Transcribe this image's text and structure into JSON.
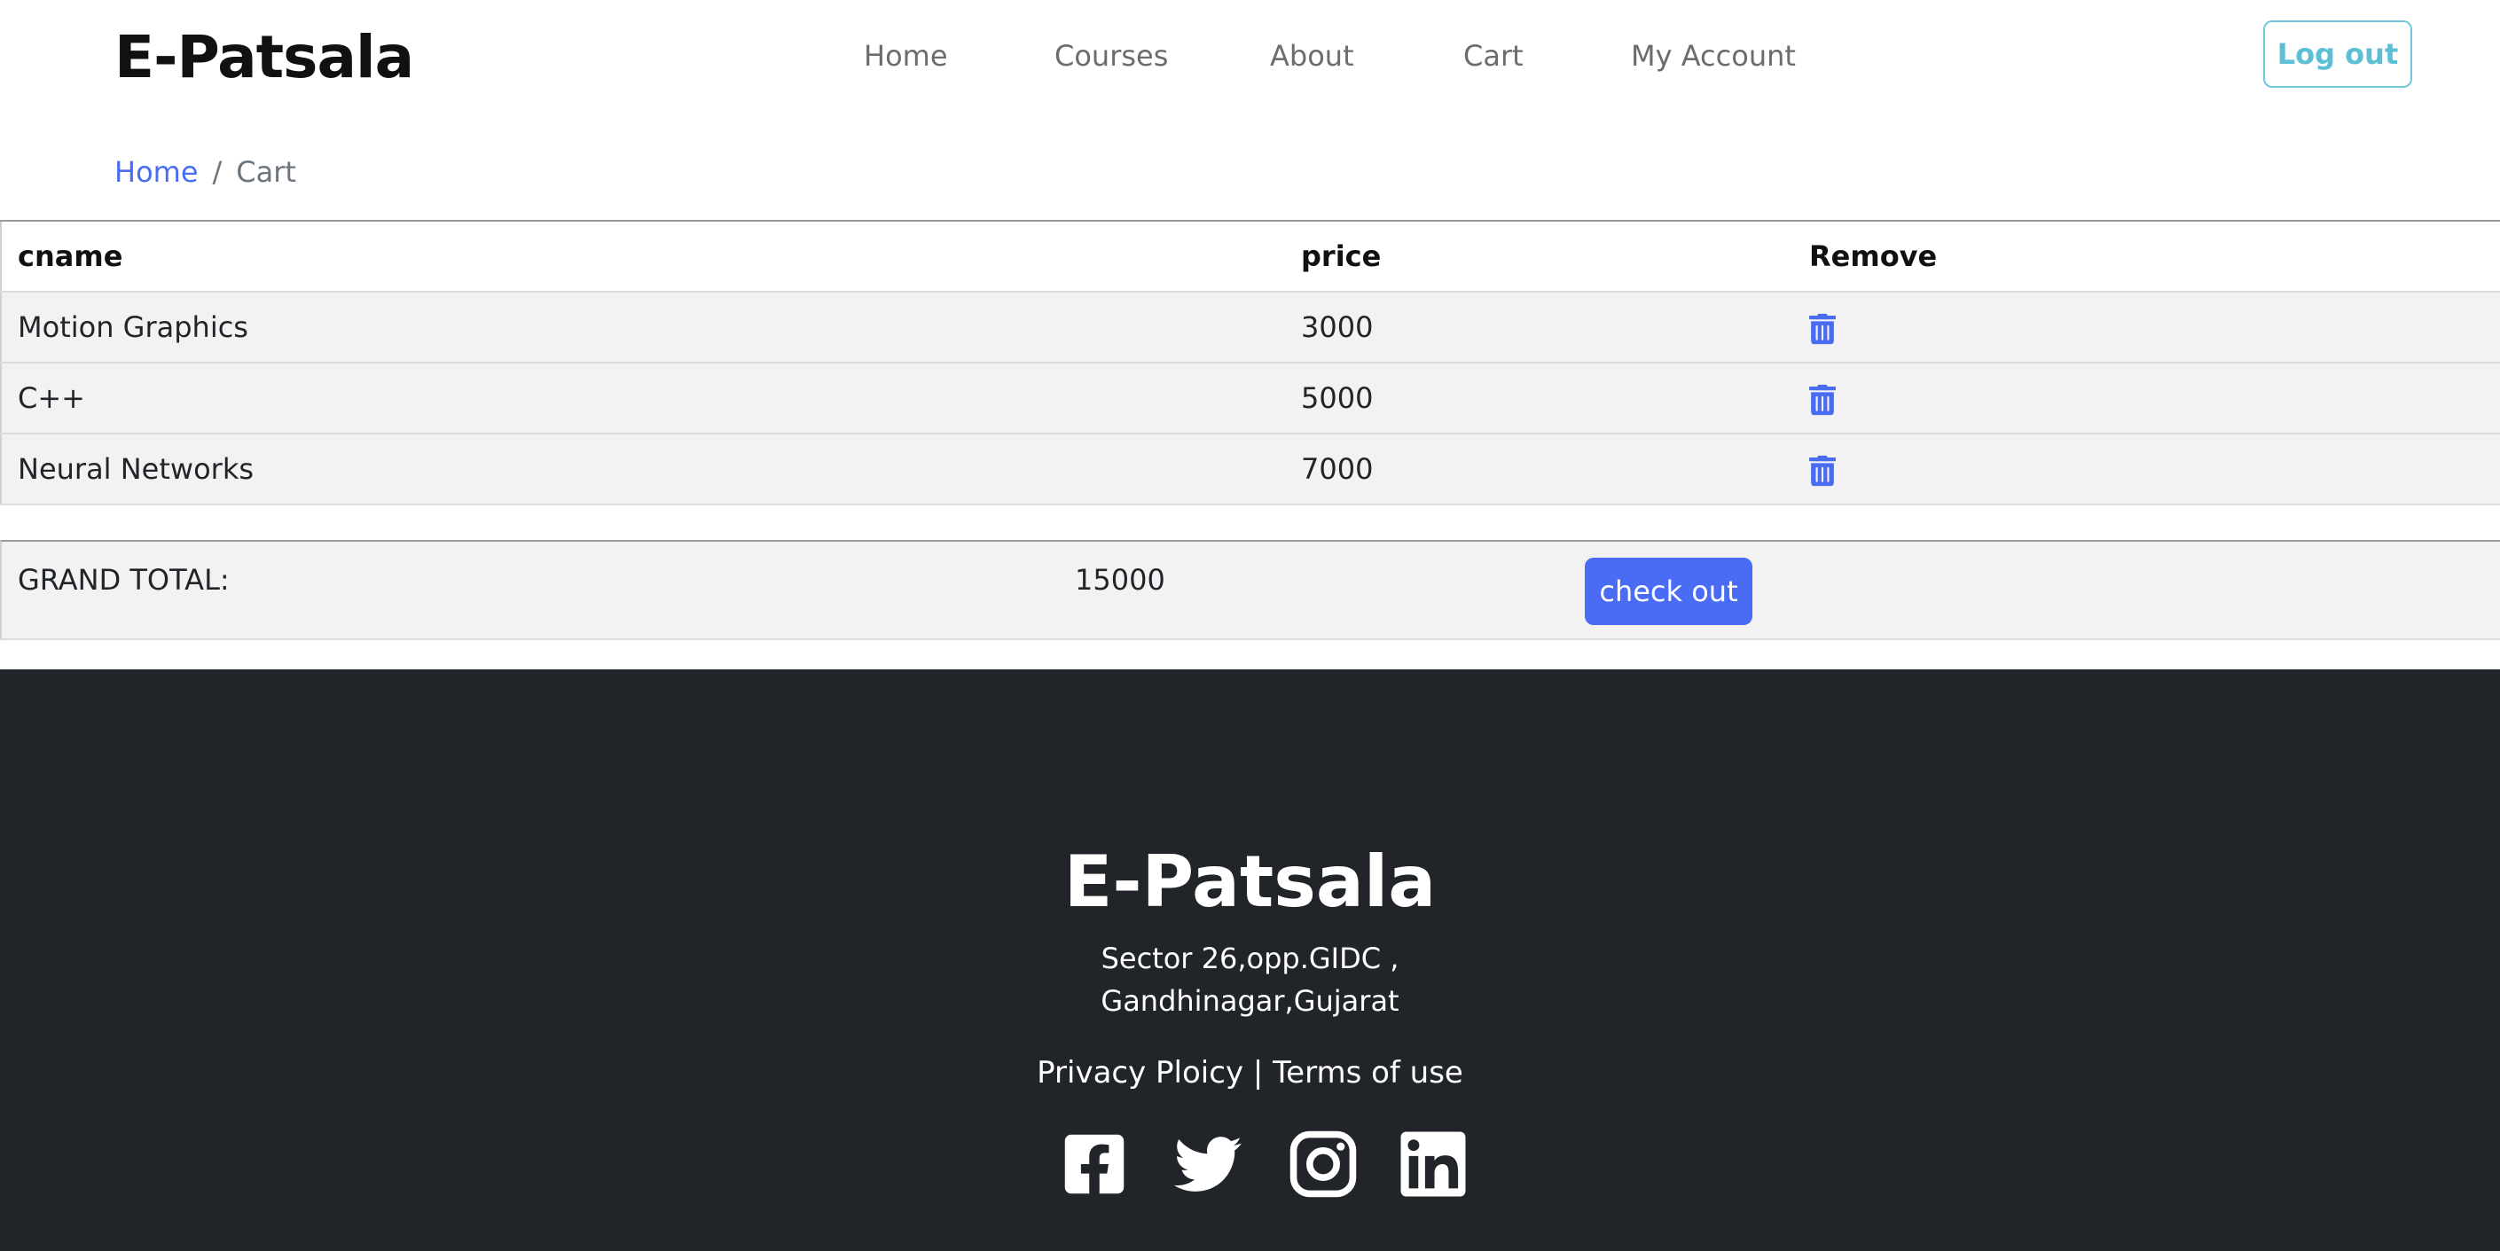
{
  "brand": "E-Patsala",
  "nav": {
    "home": "Home",
    "courses": "Courses",
    "about": "About",
    "cart": "Cart",
    "account": "My Account",
    "logout": "Log out"
  },
  "breadcrumb": {
    "home": "Home",
    "separator": "/",
    "current": "Cart"
  },
  "table": {
    "headers": {
      "name": "cname",
      "price": "price",
      "remove": "Remove"
    },
    "rows": [
      {
        "name": "Motion Graphics",
        "price": "3000",
        "icon": "trash-icon"
      },
      {
        "name": "C++",
        "price": "5000",
        "icon": "trash-icon"
      },
      {
        "name": "Neural Networks",
        "price": "7000",
        "icon": "trash-icon"
      }
    ]
  },
  "total": {
    "label": "GRAND TOTAL:",
    "value": "15000",
    "checkout_label": "check out"
  },
  "footer": {
    "brand": "E-Patsala",
    "address_line1": "Sector 26,opp.GIDC ,",
    "address_line2": "Gandhinagar,Gujarat",
    "privacy": "Privacy Ploicy",
    "divider": "|",
    "terms": "Terms of use",
    "socials": [
      "facebook-icon",
      "twitter-icon",
      "instagram-icon",
      "linkedin-icon"
    ]
  },
  "colors": {
    "accent": "#4a6cf5",
    "logout_outline": "#6ec8dc",
    "footer_bg": "#212429"
  }
}
